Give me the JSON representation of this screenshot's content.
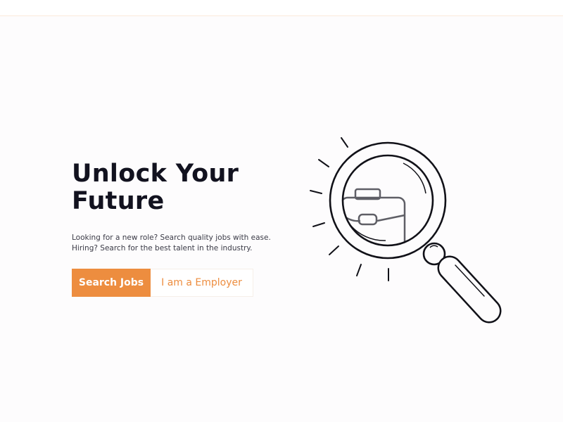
{
  "hero": {
    "title_line1": "Unlock Your",
    "title_line2": "Future",
    "description_line1": "Looking for a new role? Search quality jobs with ease.",
    "description_line2": "Hiring? Search for the best talent in the industry."
  },
  "actions": {
    "search_jobs_label": "Search Jobs",
    "employer_label": "I am a Employer"
  },
  "illustration": {
    "icon": "magnifier-briefcase-icon"
  },
  "colors": {
    "accent": "#ed8d3f",
    "title": "#12121f",
    "text": "#3a3a46",
    "background": "#fdfcfd"
  }
}
